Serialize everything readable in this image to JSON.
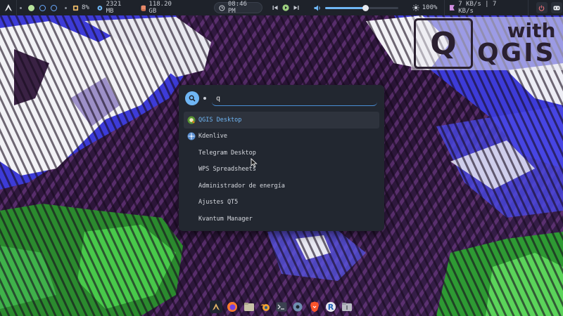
{
  "topbar": {
    "cpu": "8%",
    "memory": "2321 MB",
    "disk": "118.20 GB",
    "clock": "08:46 PM",
    "volume_level": 0.55,
    "brightness": "100%",
    "network": "7 KB/s | 7 KB/s"
  },
  "launcher": {
    "query": "q",
    "results": [
      {
        "label": "QGIS Desktop",
        "icon": "qgis-icon",
        "selected": true
      },
      {
        "label": "Kdenlive",
        "icon": "kdenlive-icon",
        "selected": false
      },
      {
        "label": "Telegram Desktop",
        "icon": "",
        "selected": false
      },
      {
        "label": "WPS Spreadsheets",
        "icon": "",
        "selected": false
      },
      {
        "label": "Administrador de energía",
        "icon": "",
        "selected": false
      },
      {
        "label": "Ajustes QT5",
        "icon": "",
        "selected": false
      },
      {
        "label": "Kvantum Manager",
        "icon": "",
        "selected": false
      }
    ]
  },
  "watermark": {
    "with": "with",
    "name": "QGIS"
  },
  "dock": {
    "apps": [
      "arch-icon",
      "firefox-icon",
      "files-icon",
      "blender-icon",
      "terminal-icon",
      "settings-icon",
      "brave-icon",
      "r-icon",
      "archive-icon"
    ]
  },
  "colors": {
    "accent": "#6fb6f4",
    "panel": "#222730",
    "bar": "#1e222a"
  }
}
